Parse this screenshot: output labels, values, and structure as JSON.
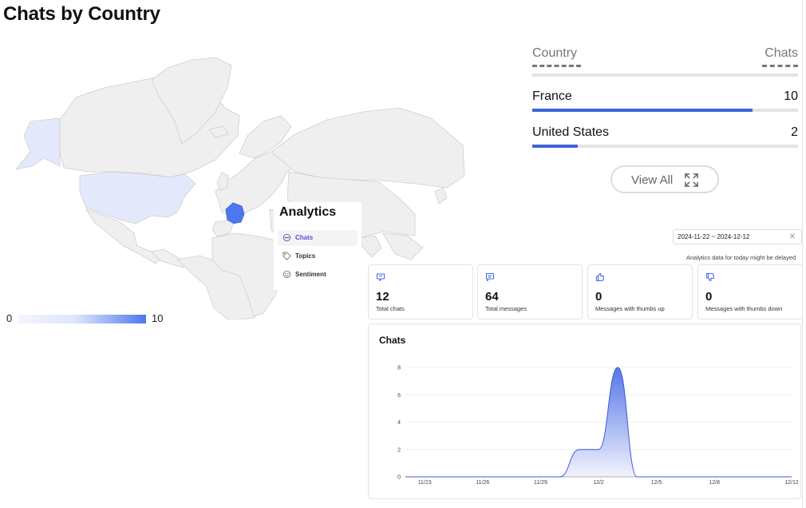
{
  "page": {
    "title": "Chats by Country"
  },
  "map": {
    "legend_min": "0",
    "legend_max": "10",
    "colors": {
      "land": "#efefef",
      "border": "#cfcfcf",
      "france": "#4d77ee",
      "united_states": "#e3e9fb",
      "alaska": "#e3e9fb"
    }
  },
  "country_table": {
    "header_country": "Country",
    "header_chats": "Chats",
    "rows": [
      {
        "country": "France",
        "chats": "10",
        "share": 0.83
      },
      {
        "country": "United States",
        "chats": "2",
        "share": 0.17
      }
    ],
    "bar_color": "#3e63dd",
    "view_all_label": "View All"
  },
  "analytics": {
    "title": "Analytics",
    "nav": [
      {
        "label": "Chats",
        "active": true,
        "icon": "chat-bubble-icon"
      },
      {
        "label": "Topics",
        "active": false,
        "icon": "tag-icon"
      },
      {
        "label": "Sentiment",
        "active": false,
        "icon": "smiley-icon"
      }
    ],
    "date_range": "2024-11-22 ~ 2024-12-12",
    "delay_note": "Analytics data for today might be delayed",
    "stats": [
      {
        "value": "12",
        "label": "Total chats",
        "icon": "chats-icon"
      },
      {
        "value": "64",
        "label": "Total messages",
        "icon": "message-icon"
      },
      {
        "value": "0",
        "label": "Messages with thumbs up",
        "icon": "thumbs-up-icon"
      },
      {
        "value": "0",
        "label": "Messages with thumbs down",
        "icon": "thumbs-down-icon"
      }
    ],
    "accent_color": "#4a6cf0"
  },
  "chart_data": {
    "type": "area",
    "title": "Chats",
    "x_ticks": [
      "11/23",
      "11/26",
      "11/29",
      "12/2",
      "12/5",
      "12/8",
      "12/12"
    ],
    "y_ticks": [
      "0",
      "2",
      "4",
      "6",
      "8"
    ],
    "ylim": [
      0,
      8
    ],
    "x": [
      "11/22",
      "11/23",
      "11/24",
      "11/25",
      "11/26",
      "11/27",
      "11/28",
      "11/29",
      "11/30",
      "12/1",
      "12/2",
      "12/3",
      "12/4",
      "12/5",
      "12/6",
      "12/7",
      "12/8",
      "12/9",
      "12/10",
      "12/11",
      "12/12"
    ],
    "series": [
      {
        "values": [
          0,
          0,
          0,
          0,
          0,
          0,
          0,
          0,
          0,
          2,
          2,
          8,
          0,
          0,
          0,
          0,
          0,
          0,
          0,
          0,
          0
        ]
      }
    ],
    "grid": true,
    "color": "#4d6fe6"
  }
}
